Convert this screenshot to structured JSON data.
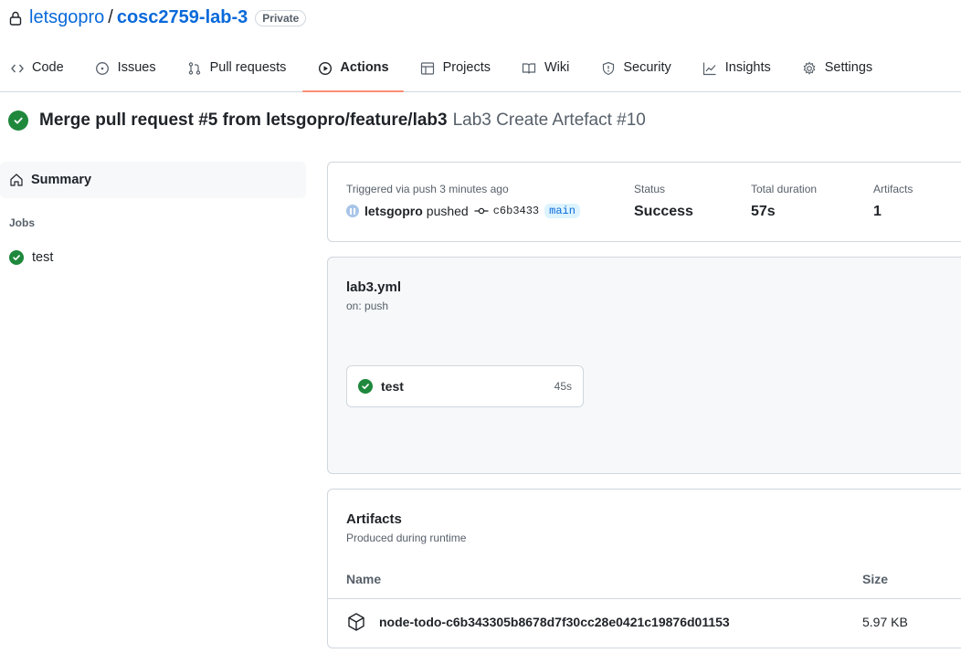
{
  "repo": {
    "owner": "letsgopro",
    "separator": "/",
    "name": "cosc2759-lab-3",
    "visibility": "Private"
  },
  "tabs": [
    {
      "label": "Code",
      "icon": "code-icon"
    },
    {
      "label": "Issues",
      "icon": "issue-icon"
    },
    {
      "label": "Pull requests",
      "icon": "pull-request-icon"
    },
    {
      "label": "Actions",
      "icon": "play-icon",
      "active": true
    },
    {
      "label": "Projects",
      "icon": "table-icon"
    },
    {
      "label": "Wiki",
      "icon": "book-icon"
    },
    {
      "label": "Security",
      "icon": "shield-icon"
    },
    {
      "label": "Insights",
      "icon": "graph-icon"
    },
    {
      "label": "Settings",
      "icon": "gear-icon"
    }
  ],
  "run": {
    "title": "Merge pull request #5 from letsgopro/feature/lab3",
    "workflow_label": "Lab3 Create Artefact #10"
  },
  "sidebar": {
    "summary_label": "Summary",
    "jobs_heading": "Jobs",
    "jobs": [
      {
        "label": "test"
      }
    ]
  },
  "summary": {
    "trigger_label": "Triggered via push 3 minutes ago",
    "pusher": "letsgopro",
    "pushed_text": "pushed",
    "commit": "c6b3433",
    "branch": "main",
    "status_label": "Status",
    "status_value": "Success",
    "duration_label": "Total duration",
    "duration_value": "57s",
    "artifacts_label": "Artifacts",
    "artifacts_value": "1"
  },
  "workflow": {
    "file": "lab3.yml",
    "on": "on: push",
    "job_name": "test",
    "job_duration": "45s"
  },
  "artifacts": {
    "title": "Artifacts",
    "subtitle": "Produced during runtime",
    "col_name": "Name",
    "col_size": "Size",
    "rows": [
      {
        "name": "node-todo-c6b343305b8678d7f30cc28e0421c19876d01153",
        "size": "5.97 KB"
      }
    ]
  },
  "colors": {
    "success": "#1f883d",
    "link": "#0969da",
    "active_tab_underline": "#fd8c73"
  }
}
